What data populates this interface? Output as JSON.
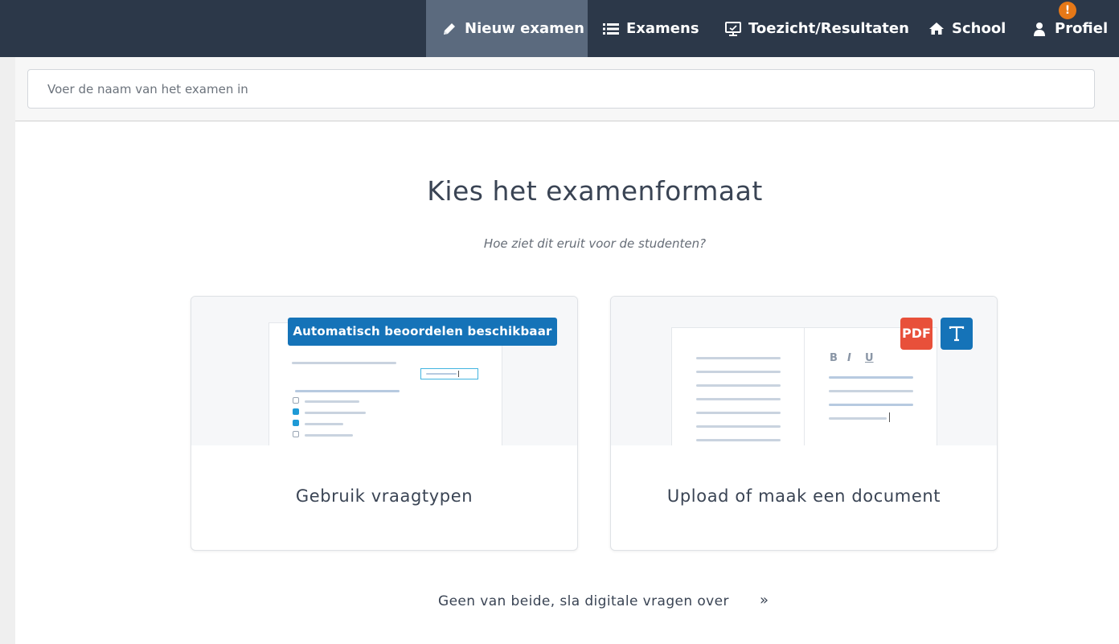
{
  "nav": {
    "items": [
      {
        "label": "Nieuw examen",
        "icon": "pencil-icon"
      },
      {
        "label": "Examens",
        "icon": "list-icon"
      },
      {
        "label": "Toezicht/Resultaten",
        "icon": "monitor-icon"
      },
      {
        "label": "School",
        "icon": "home-icon"
      },
      {
        "label": "Profiel",
        "icon": "user-icon"
      }
    ],
    "active_index": 0,
    "profile_alert": "!"
  },
  "search": {
    "placeholder": "Voer de naam van het examen in",
    "value": ""
  },
  "main": {
    "title": "Kies het examenformaat",
    "subtitle": "Hoe ziet dit eruit voor de studenten?",
    "cards": [
      {
        "label": "Gebruik vraagtypen",
        "badge": "Automatisch beoordelen beschikbaar"
      },
      {
        "label": "Upload of maak een document",
        "badges": [
          "PDF",
          "T"
        ],
        "toolbar": [
          "B",
          "I",
          "U"
        ]
      }
    ],
    "skip_label": "Geen van beide, sla digitale vragen over",
    "skip_chevron": "»"
  },
  "colors": {
    "topbar": "#2c3849",
    "active_nav": "#5b6a7e",
    "brand_blue": "#1573b8",
    "pdf_red": "#e8503a",
    "alert_orange": "#e67817"
  }
}
